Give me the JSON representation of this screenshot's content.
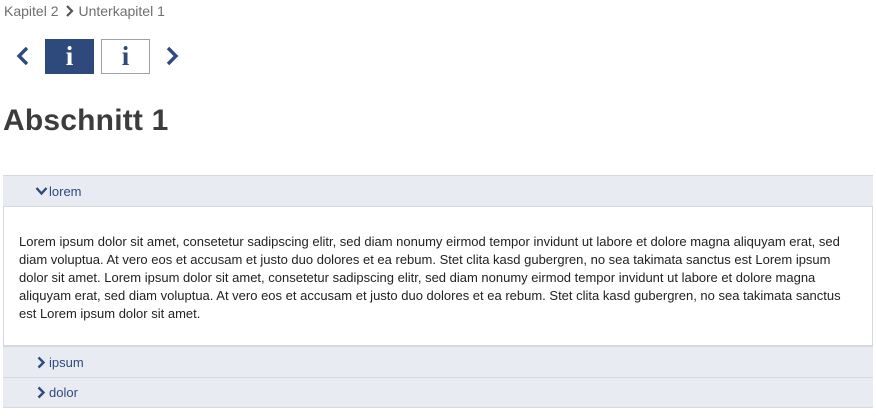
{
  "breadcrumb": {
    "items": [
      "Kapitel 2",
      "Unterkapitel 1"
    ],
    "separator_icon": "chevron-right-icon"
  },
  "slide_nav": {
    "prev_icon": "chevron-left-icon",
    "next_icon": "chevron-right-icon",
    "slides": [
      {
        "glyph": "i",
        "state": "active"
      },
      {
        "glyph": "i",
        "state": "inactive"
      }
    ]
  },
  "title": "Abschnitt 1",
  "accordion": {
    "sections": [
      {
        "label": "lorem",
        "expanded": true,
        "content": "Lorem ipsum dolor sit amet, consetetur sadipscing elitr, sed diam nonumy eirmod tempor invidunt ut labore et dolore magna aliquyam erat, sed diam voluptua. At vero eos et accusam et justo duo dolores et ea rebum. Stet clita kasd gubergren, no sea takimata sanctus est Lorem ipsum dolor sit amet. Lorem ipsum dolor sit amet, consetetur sadipscing elitr, sed diam nonumy eirmod tempor invidunt ut labore et dolore magna aliquyam erat, sed diam voluptua. At vero eos et accusam et justo duo dolores et ea rebum. Stet clita kasd gubergren, no sea takimata sanctus est Lorem ipsum dolor sit amet."
      },
      {
        "label": "ipsum",
        "expanded": false
      },
      {
        "label": "dolor",
        "expanded": false
      }
    ]
  },
  "colors": {
    "accent": "#2e4a7d",
    "accordion_header_bg": "#e8ebf1",
    "border": "#d4d9e1",
    "muted_text": "#6f6f6f"
  }
}
